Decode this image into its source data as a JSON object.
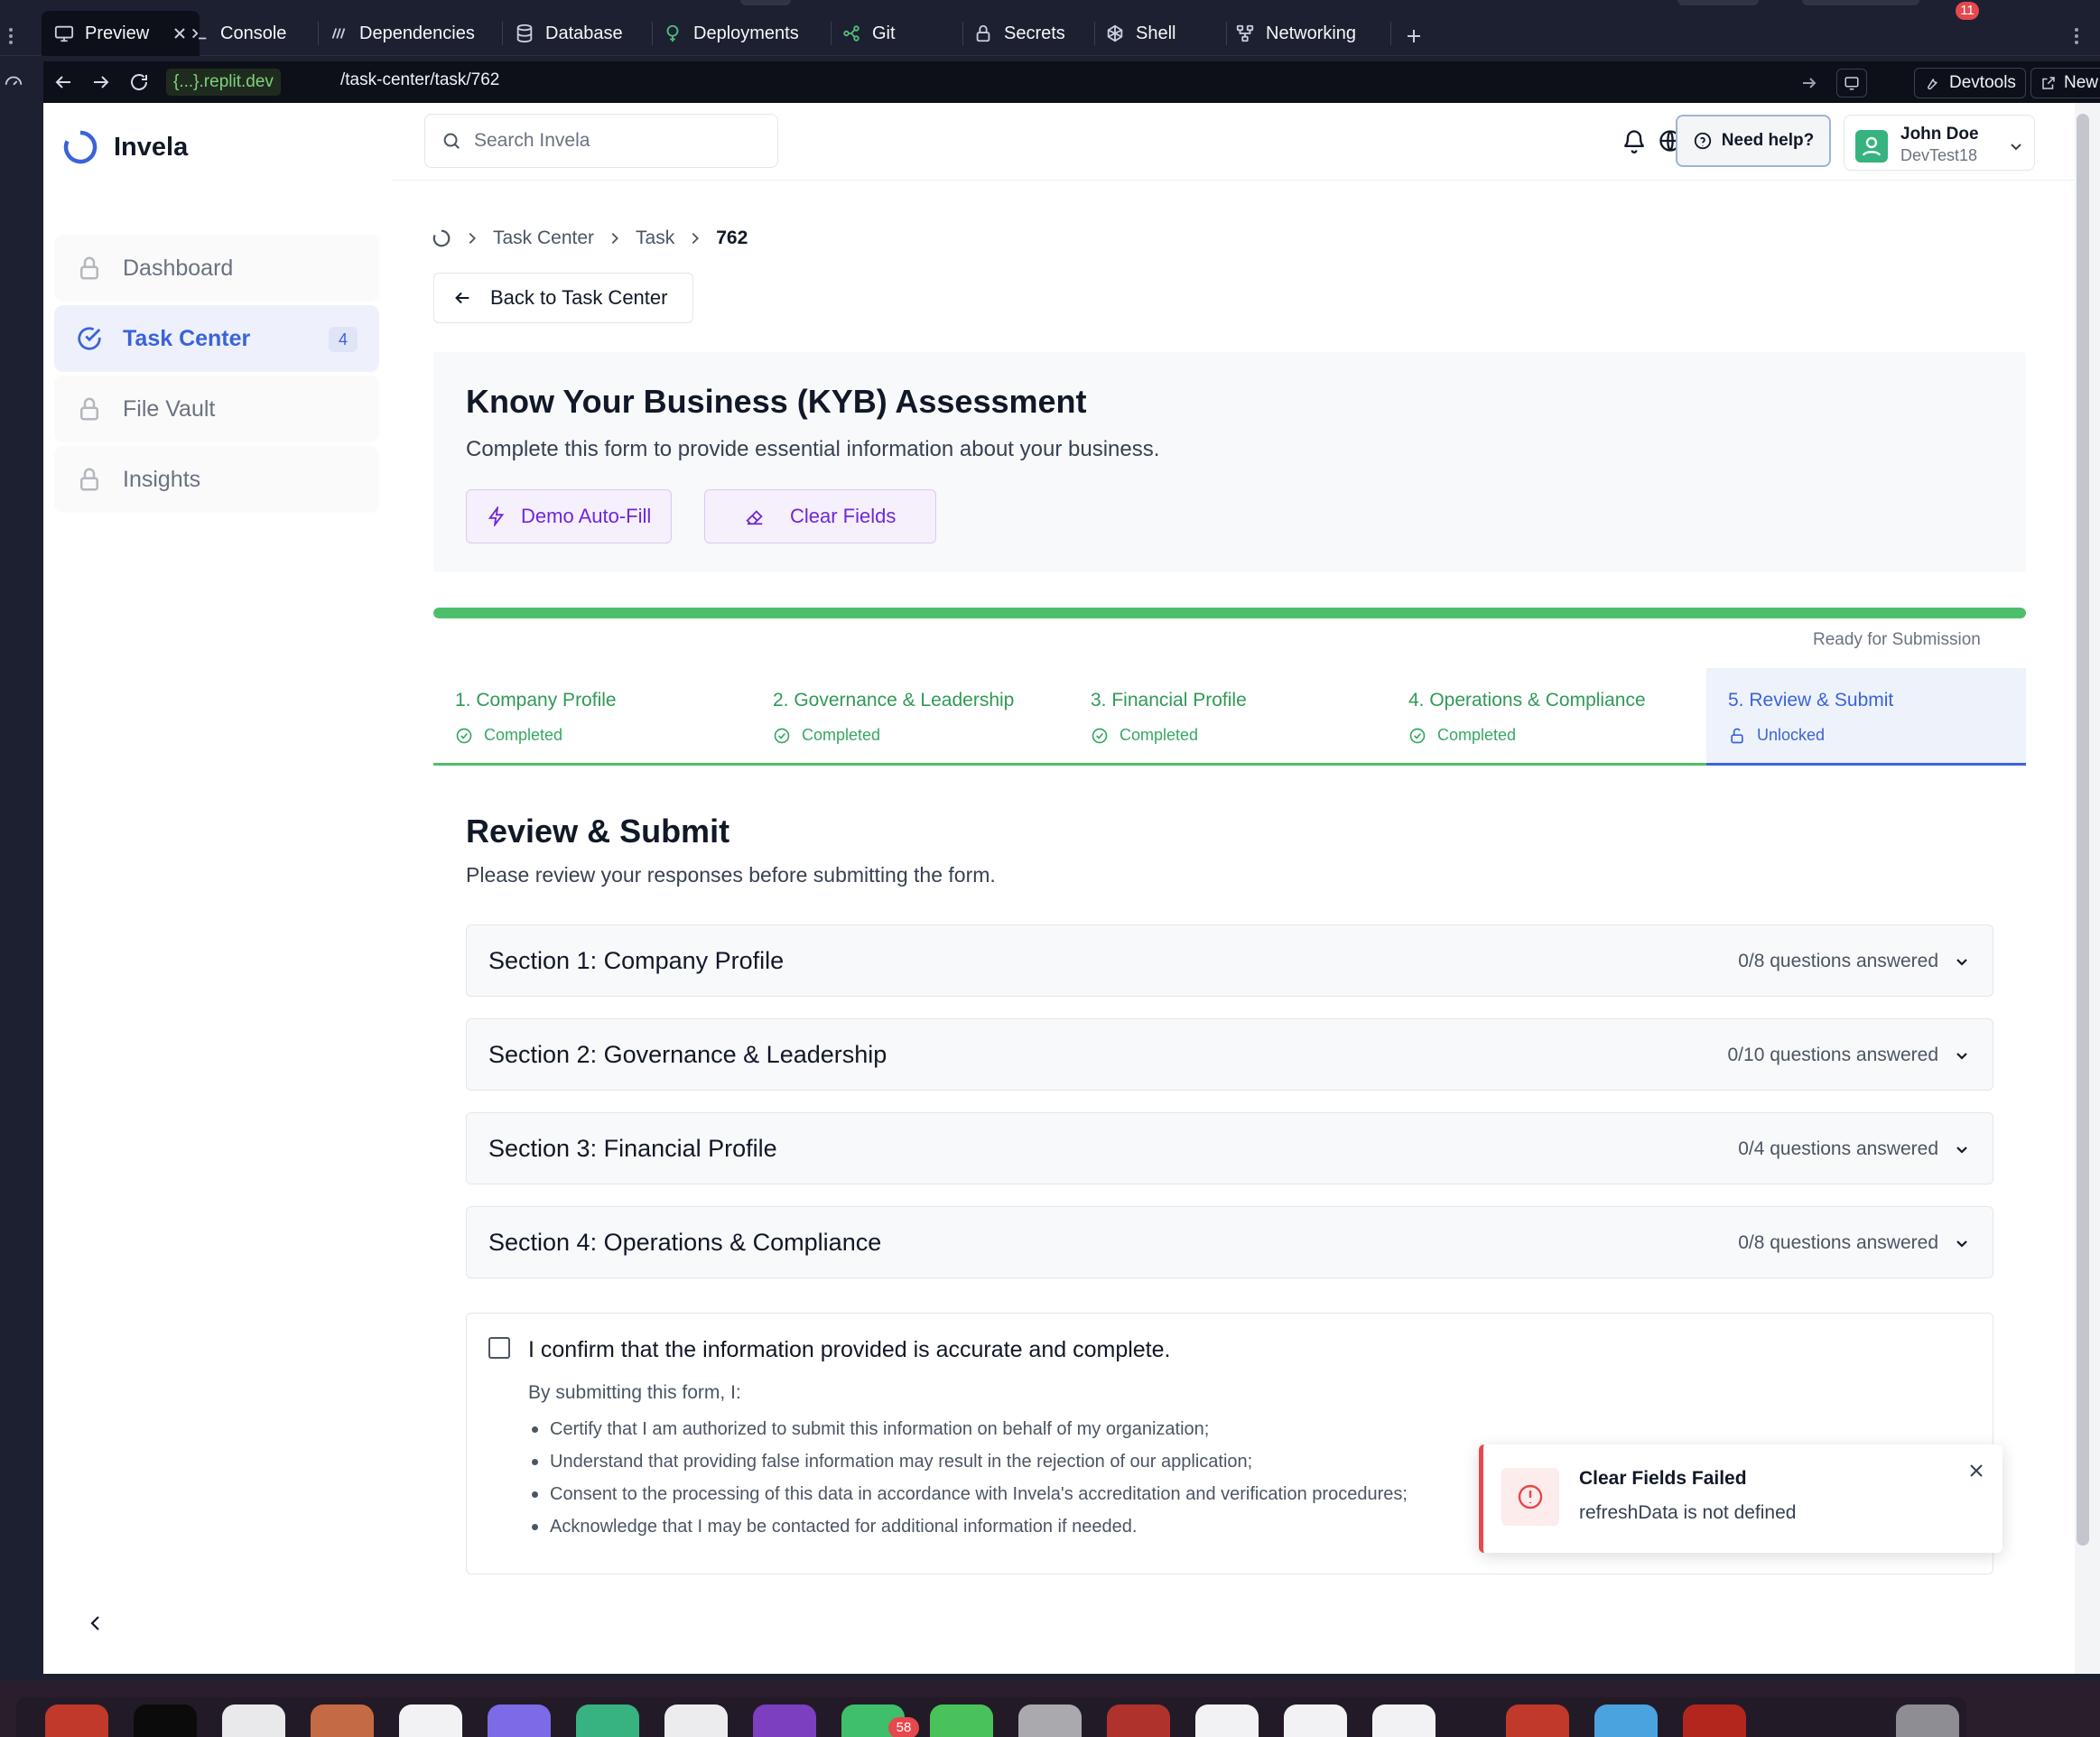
{
  "browser": {
    "tabs": [
      {
        "label": "Preview",
        "icon": "monitor-icon"
      },
      {
        "label": "Console",
        "icon": "terminal-icon"
      },
      {
        "label": "Dependencies",
        "icon": "package-icon"
      },
      {
        "label": "Database",
        "icon": "database-icon"
      },
      {
        "label": "Deployments",
        "icon": "rocket-icon"
      },
      {
        "label": "Git",
        "icon": "git-branch-icon"
      },
      {
        "label": "Secrets",
        "icon": "lock-icon"
      },
      {
        "label": "Shell",
        "icon": "shell-icon"
      },
      {
        "label": "Networking",
        "icon": "network-icon"
      }
    ],
    "url_domain": "{...}.replit.dev",
    "url_path": "/task-center/task/762",
    "devtools_label": "Devtools",
    "devtools_badge": "11",
    "newtab_label": "New tab"
  },
  "app": {
    "brand": "Invela",
    "sidebar": {
      "items": [
        {
          "label": "Dashboard",
          "icon": "lock-icon",
          "active": false
        },
        {
          "label": "Task Center",
          "icon": "check-circle-icon",
          "active": true,
          "badge": "4"
        },
        {
          "label": "File Vault",
          "icon": "lock-icon",
          "active": false
        },
        {
          "label": "Insights",
          "icon": "lock-icon",
          "active": false
        }
      ]
    },
    "header": {
      "search_placeholder": "Search Invela",
      "help_label": "Need help?",
      "user_name": "John Doe",
      "user_org": "DevTest18"
    },
    "breadcrumb": {
      "items": [
        "Task Center",
        "Task"
      ],
      "current": "762"
    },
    "back_label": "Back to Task Center",
    "kyb": {
      "title": "Know Your Business (KYB) Assessment",
      "subtitle": "Complete this form to provide essential information about your business.",
      "autofill_label": "Demo Auto-Fill",
      "clear_label": "Clear Fields"
    },
    "progress": {
      "fraction": 1.0,
      "status": "Ready for Submission"
    },
    "steps": [
      {
        "label": "1. Company Profile",
        "status": "Completed"
      },
      {
        "label": "2. Governance & Leadership",
        "status": "Completed"
      },
      {
        "label": "3. Financial Profile",
        "status": "Completed"
      },
      {
        "label": "4. Operations & Compliance",
        "status": "Completed"
      },
      {
        "label": "5. Review & Submit",
        "status": "Unlocked"
      }
    ],
    "review": {
      "title": "Review & Submit",
      "subtitle": "Please review your responses before submitting the form.",
      "sections": [
        {
          "title": "Section 1: Company Profile",
          "count": "0/8 questions answered"
        },
        {
          "title": "Section 2: Governance & Leadership",
          "count": "0/10 questions answered"
        },
        {
          "title": "Section 3: Financial Profile",
          "count": "0/4 questions answered"
        },
        {
          "title": "Section 4: Operations & Compliance",
          "count": "0/8 questions answered"
        }
      ],
      "confirm_label": "I confirm that the information provided is accurate and complete.",
      "confirm_intro": "By submitting this form, I:",
      "confirm_points": [
        "Certify that I am authorized to submit this information on behalf of my organization;",
        "Understand that providing false information may result in the rejection of our application;",
        "Consent to the processing of this data in accordance with Invela's accreditation and verification procedures;",
        "Acknowledge that I may be contacted for additional information if needed."
      ]
    },
    "toast": {
      "title": "Clear Fields Failed",
      "message": "refreshData is not defined"
    }
  },
  "dock": {
    "badge": "58"
  },
  "colors": {
    "accent": "#3b63d9",
    "success": "#4cbf6a",
    "purple": "#6d28d9",
    "error": "#e5484d"
  }
}
